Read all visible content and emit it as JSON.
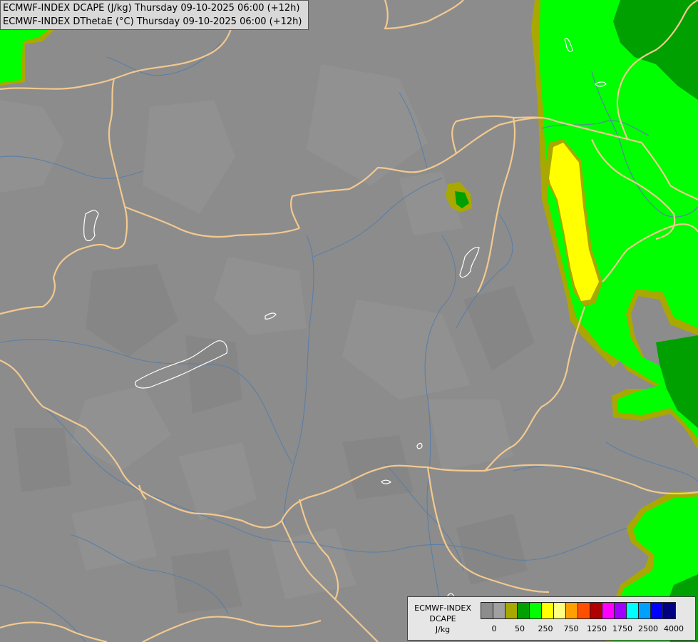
{
  "title": {
    "line1": "ECMWF-INDEX DCAPE (J/kg) Thursday 09-10-2025 06:00 (+12h)",
    "line2": "ECMWF-INDEX DThetaE (°C) Thursday 09-10-2025 06:00 (+12h)"
  },
  "legend": {
    "title_lines": [
      "ECMWF-INDEX",
      "DCAPE",
      "J/kg"
    ],
    "colors": [
      "#8c8c8c",
      "#a0a0a0",
      "#a8a800",
      "#00a000",
      "#00ff00",
      "#ffff00",
      "#ffff80",
      "#ffa000",
      "#ff5000",
      "#b00000",
      "#ff00ff",
      "#a000ff",
      "#00ffff",
      "#00a0ff",
      "#0000ff",
      "#000080"
    ],
    "ticks": [
      "0",
      "50",
      "250",
      "750",
      "1250",
      "1750",
      "2500",
      "4000"
    ]
  },
  "colors": {
    "background": "#8c8c8c",
    "borders": "#f2c98f",
    "rivers": "#5b7fa6",
    "lakes": "#ffffff",
    "dcape_low": "#a8a800",
    "dcape_mid": "#00a000",
    "dcape_high": "#00ff00",
    "dcape_max": "#ffff00"
  }
}
